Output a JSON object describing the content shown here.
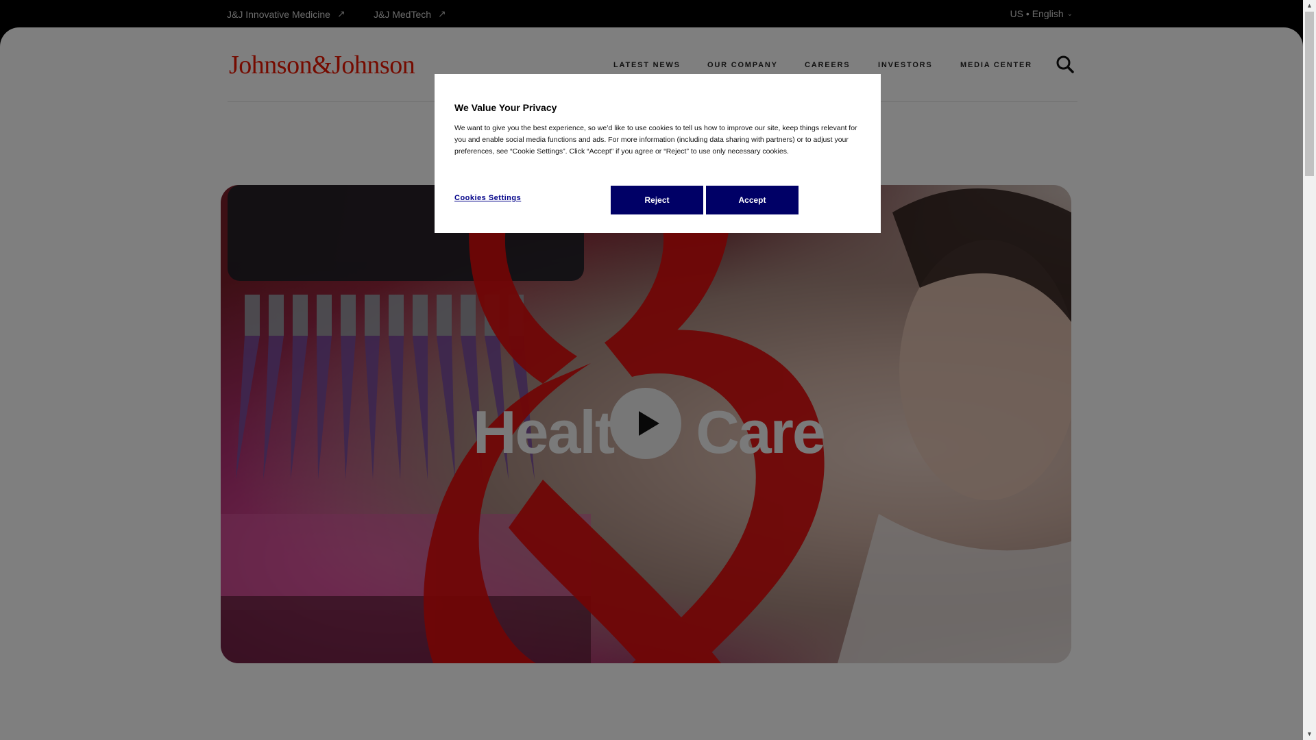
{
  "utility_bar": {
    "links": [
      {
        "label": "J&J Innovative Medicine",
        "icon": "external-arrow-icon"
      },
      {
        "label": "J&J MedTech",
        "icon": "external-arrow-icon"
      }
    ],
    "language": "US • English"
  },
  "header": {
    "logo_text": "Johnson&Johnson",
    "nav": [
      "LATEST NEWS",
      "OUR COMPANY",
      "CAREERS",
      "INVESTORS",
      "MEDIA CENTER"
    ],
    "search_icon": "search-icon"
  },
  "hero": {
    "headline_left": "Healt",
    "headline_right": "Care",
    "play_icon": "play-icon"
  },
  "cookie_modal": {
    "title": "We Value Your Privacy",
    "body": "We want to give you the best experience, so we’d like to use cookies to tell us how to improve our site, keep things relevant for you and enable social media functions and ads. For more information (including data sharing with partners) or to adjust your preferences, see “Cookie Settings”. Click “Accept” if you agree or “Reject” to use only necessary cookies.",
    "settings_label": "Cookies Settings",
    "reject_label": "Reject",
    "accept_label": "Accept"
  },
  "colors": {
    "brand_red": "#eb1700",
    "button_navy": "#000066",
    "link_navy": "#000088"
  }
}
